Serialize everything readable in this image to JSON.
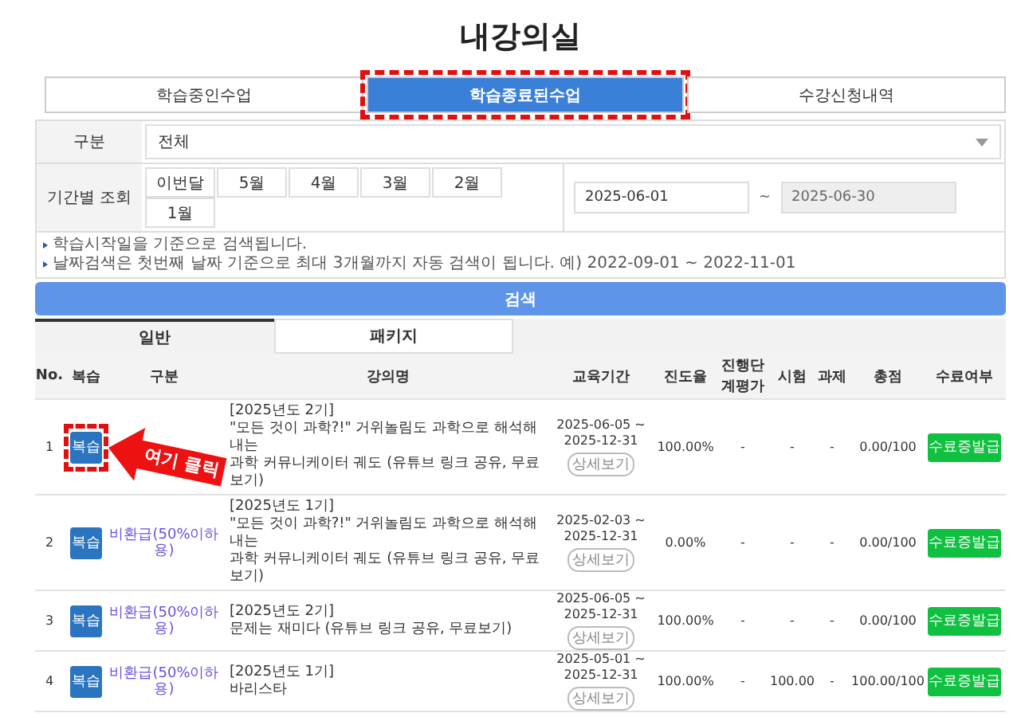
{
  "page_title": "내강의실",
  "tabs": [
    {
      "label": "학습중인수업",
      "selected": false
    },
    {
      "label": "학습종료된수업",
      "selected": true
    },
    {
      "label": "수강신청내역",
      "selected": false
    }
  ],
  "filter": {
    "category_label": "구분",
    "category_value": "전체",
    "period_label": "기간별 조회",
    "months": [
      {
        "label": "이번달",
        "selected": false
      },
      {
        "label": "5월",
        "selected": false
      },
      {
        "label": "4월",
        "selected": false
      },
      {
        "label": "3월",
        "selected": false
      },
      {
        "label": "2월",
        "selected": false
      },
      {
        "label": "1월",
        "selected": false
      }
    ],
    "start_date": "2025-06-01",
    "separator": "~",
    "end_date": "2025-06-30",
    "notes": [
      "학습시작일을 기준으로 검색됩니다.",
      "날짜검색은 첫번째 날짜 기준으로 최대 3개월까지 자동 검색이 됩니다. 예) 2022-09-01 ~ 2022-11-01"
    ],
    "search_button": "검색"
  },
  "sub_tabs": [
    {
      "label": "일반",
      "selected": true
    },
    {
      "label": "패키지",
      "selected": false
    }
  ],
  "table": {
    "columns": [
      "No.",
      "복습",
      "구분",
      "강의명",
      "교육기간",
      "진도율",
      "진행단계평가",
      "시험",
      "과제",
      "총점",
      "수료여부"
    ],
    "rows": [
      {
        "no": "1",
        "review": "복습",
        "title": [
          "[2025년도 2기]",
          "\"모든 것이 과학?!\" 거위놀림도 과학으로 해석해내는",
          "과학 커뮤니케이터 궤도 (유튜브 링크 공유, 무료보기)"
        ],
        "period": "2025-06-05 ~ 2025-12-31",
        "detail": "상세보기",
        "progress": "100.00%",
        "stage": "-",
        "exam": "-",
        "task": "-",
        "total": "0.00/100",
        "cert": "수료증발급"
      },
      {
        "no": "2",
        "review": "복습",
        "type": "비환급(50%이하용)",
        "title": [
          "[2025년도 1기]",
          "\"모든 것이 과학?!\" 거위놀림도 과학으로 해석해내는",
          "과학 커뮤니케이터 궤도 (유튜브 링크 공유, 무료보기)"
        ],
        "period": "2025-02-03 ~ 2025-12-31",
        "detail": "상세보기",
        "progress": "0.00%",
        "stage": "-",
        "exam": "-",
        "task": "-",
        "total": "0.00/100",
        "cert": "수료증발급"
      },
      {
        "no": "3",
        "review": "복습",
        "type": "비환급(50%이하용)",
        "title": [
          "[2025년도 2기]",
          "문제는 재미다 (유튜브 링크 공유, 무료보기)"
        ],
        "period": "2025-06-05 ~ 2025-12-31",
        "detail": "상세보기",
        "progress": "100.00%",
        "stage": "-",
        "exam": "-",
        "task": "-",
        "total": "0.00/100",
        "cert": "수료증발급"
      },
      {
        "no": "4",
        "review": "복습",
        "type": "비환급(50%이하용)",
        "title": [
          "[2025년도 1기]",
          "바리스타"
        ],
        "period": "2025-05-01 ~ 2025-12-31",
        "detail": "상세보기",
        "progress": "100.00%",
        "stage": "-",
        "exam": "100.00",
        "task": "-",
        "total": "100.00/100",
        "cert": "수료증발급"
      }
    ]
  },
  "annotation": {
    "label": "여기 클릭"
  }
}
